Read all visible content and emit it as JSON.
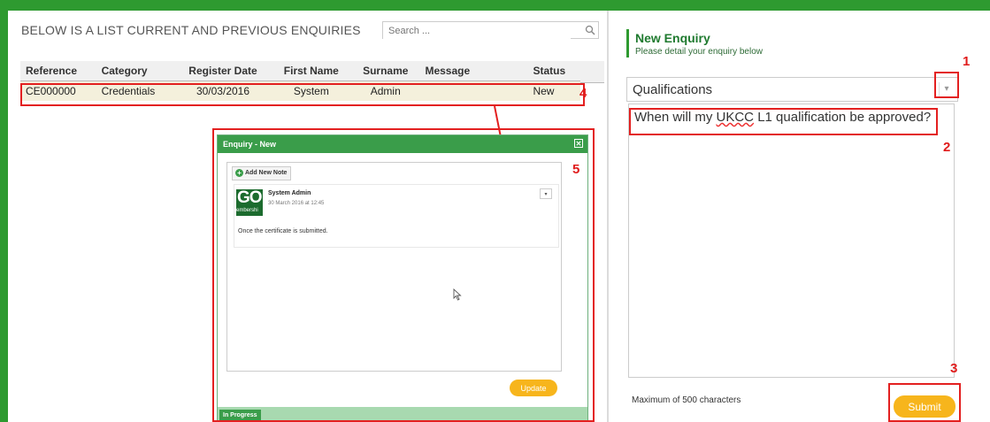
{
  "list": {
    "title": "BELOW IS A LIST CURRENT AND PREVIOUS ENQUIRIES",
    "search_placeholder": "Search ...",
    "columns": [
      "Reference",
      "Category",
      "Register Date",
      "First Name",
      "Surname",
      "Message",
      "Status"
    ],
    "rows": [
      {
        "reference": "CE000000",
        "category": "Credentials",
        "register_date": "30/03/2016",
        "first_name": "System",
        "surname": "Admin",
        "message": "",
        "status": "New"
      }
    ]
  },
  "dialog": {
    "title": "Enquiry - New",
    "add_note_label": "Add New Note",
    "note": {
      "logo_big": "GO",
      "logo_small": "embershi",
      "author": "System Admin",
      "date": "30 March 2016 at 12:45",
      "text": "Once the certificate is submitted."
    },
    "update_label": "Update",
    "status_label": "In Progress"
  },
  "new_enquiry": {
    "title": "New Enquiry",
    "subtitle": "Please detail your enquiry below",
    "category_selected": "Qualifications",
    "message_pre": "When will my ",
    "message_squiggle": "UKCC",
    "message_post": " L1 qualification be approved?",
    "max_chars": "Maximum of 500 characters",
    "submit_label": "Submit"
  },
  "annotations": [
    "1",
    "2",
    "3",
    "4",
    "5"
  ],
  "colors": {
    "accent_green": "#2e9a30",
    "button_yellow": "#f7b51c",
    "annotation_red": "#e32020"
  },
  "icons": [
    "search-icon",
    "plus-icon",
    "close-icon",
    "dropdown-arrow-icon",
    "cursor-icon"
  ]
}
